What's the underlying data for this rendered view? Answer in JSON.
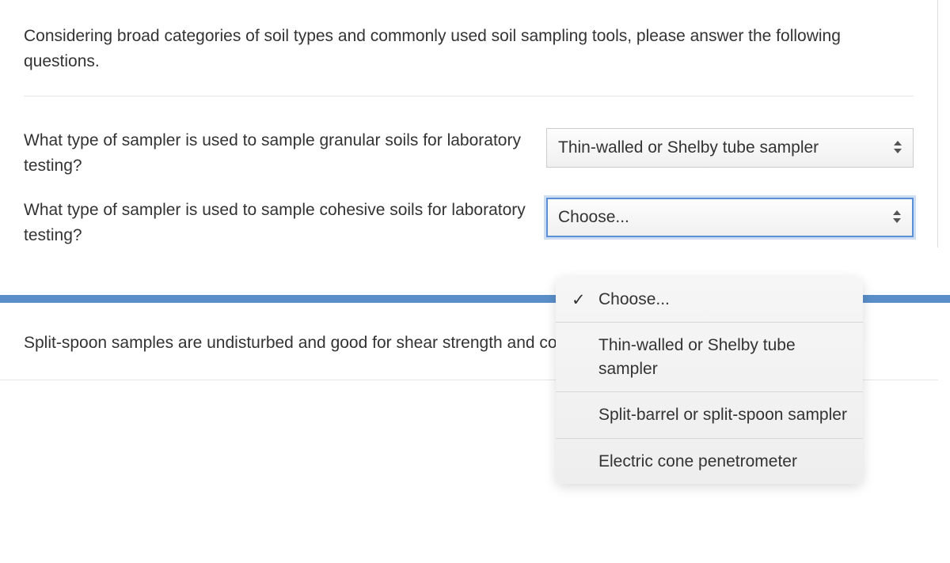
{
  "intro": "Considering broad categories of soil types and commonly used soil sampling tools, please answer the following questions.",
  "q1": {
    "label": "What type of sampler is used to sample granular soils for laboratory testing?",
    "selected": "Thin-walled or Shelby tube sampler"
  },
  "q2": {
    "label": "What type of sampler is used to sample cohesive soils for laboratory testing?",
    "selected": "Choose..."
  },
  "dropdown": {
    "opt0": "Choose...",
    "opt1": "Thin-walled or Shelby tube sampler",
    "opt2": "Split-barrel or split-spoon sampler",
    "opt3": "Electric cone penetrometer"
  },
  "statement": "Split-spoon samples are undisturbed and good for shear strength and consolidation testing.",
  "glyph": {
    "caret": "◆",
    "check": "✓"
  }
}
